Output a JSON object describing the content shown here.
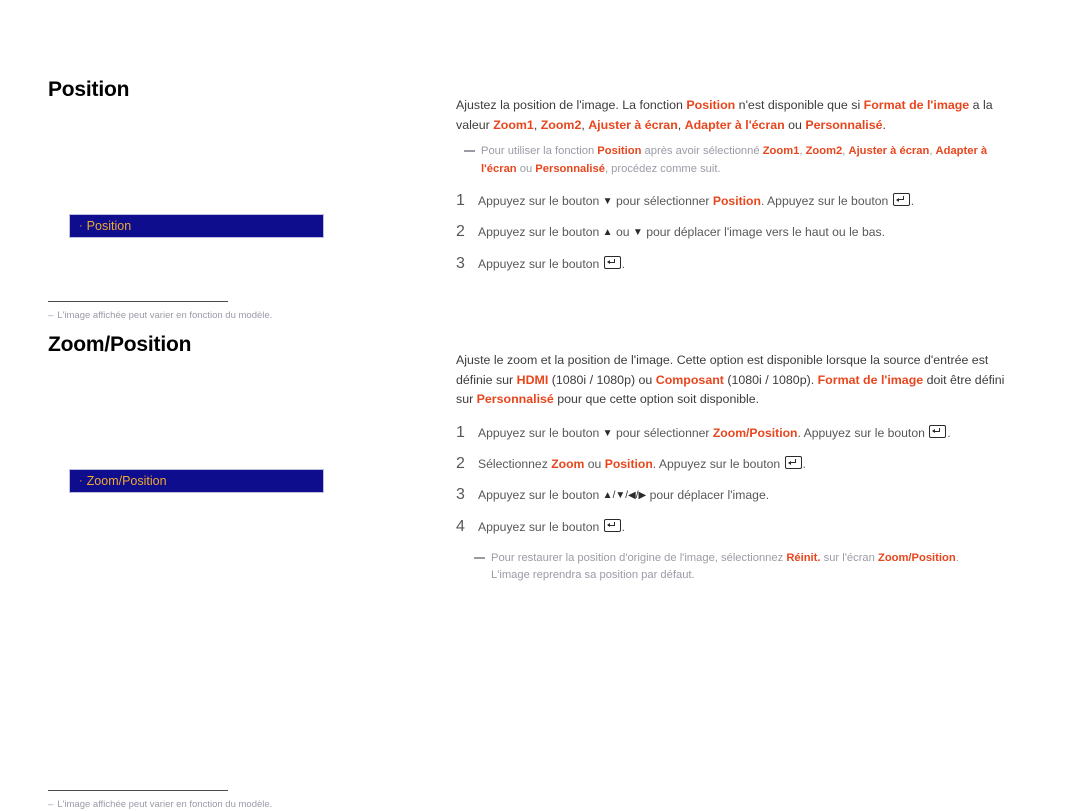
{
  "meta": {
    "accent_highlight": "#e8461d",
    "osd_panel_bg": "#0d0d8e",
    "osd_panel_text": "#f0a830",
    "body_text": "#58585b",
    "note_text": "#9b9ba6"
  },
  "sections": [
    {
      "id": "position",
      "heading": "Position",
      "osd_panel": {
        "bullet": "·",
        "label": "Position"
      },
      "footnote": {
        "dash": "–",
        "text": "L'image affichée peut varier en fonction du modèle."
      },
      "intro": {
        "p1_a": "Ajustez la position de l'image. La fonction ",
        "p1_hl1": "Position",
        "p1_b": " n'est disponible que si ",
        "p1_hl2": "Format de l'image",
        "p1_c": " a la valeur ",
        "p1_hl3": "Zoom1",
        "p1_d": ", ",
        "p1_hl4": "Zoom2",
        "p1_e": ", ",
        "p1_hl5": "Ajuster à écran",
        "p1_f": ", ",
        "p1_hl6": "Adapter à l'écran",
        "p1_g": " ou ",
        "p1_hl7": "Personnalisé",
        "p1_h": "."
      },
      "note": {
        "a": "Pour utiliser la fonction ",
        "hl1": "Position",
        "b": " après avoir sélectionné ",
        "hl2": "Zoom1",
        "c": ", ",
        "hl3": "Zoom2",
        "d": ", ",
        "hl4": "Ajuster à écran",
        "e": ", ",
        "hl5": "Adapter à l'écran",
        "f": " ou ",
        "hl6": "Personnalisé",
        "g": ", procédez comme suit."
      },
      "steps": [
        {
          "num": "1",
          "a": "Appuyez sur le bouton ",
          "arrow1": "▼",
          "b": " pour sélectionner ",
          "hl": "Position",
          "c": ". Appuyez sur le bouton ",
          "d": "."
        },
        {
          "num": "2",
          "a": "Appuyez sur le bouton ",
          "arrow1": "▲",
          "b": " ou ",
          "arrow2": "▼",
          "c": " pour déplacer l'image vers le haut ou le bas."
        },
        {
          "num": "3",
          "a": "Appuyez sur le bouton ",
          "d": "."
        }
      ]
    },
    {
      "id": "zoomposition",
      "heading": "Zoom/Position",
      "osd_panel": {
        "bullet": "·",
        "label": "Zoom/Position"
      },
      "footnote": {
        "dash": "–",
        "text": "L'image affichée peut varier en fonction du modèle."
      },
      "intro": {
        "p1_a": "Ajuste le zoom et la position de l'image. Cette option est disponible lorsque la source d'entrée est définie sur ",
        "p1_hl1": "HDMI",
        "p1_b": " (1080i / 1080p) ou ",
        "p1_hl2": "Composant",
        "p1_c": " (1080i / 1080p). ",
        "p1_hl3": "Format de l'image",
        "p1_d": " doit être défini sur ",
        "p1_hl4": "Personnalisé",
        "p1_e": " pour que cette option soit disponible."
      },
      "steps": [
        {
          "num": "1",
          "a": "Appuyez sur le bouton ",
          "arrow1": "▼",
          "b": " pour sélectionner ",
          "hl": "Zoom/Position",
          "c": ". Appuyez sur le bouton ",
          "d": "."
        },
        {
          "num": "2",
          "a": "Sélectionnez ",
          "hl": "Zoom",
          "b": " ou ",
          "hl2": "Position",
          "c": ". Appuyez sur le bouton ",
          "d": "."
        },
        {
          "num": "3",
          "a": "Appuyez sur le bouton ",
          "arrows": "▲/▼/◀/▶",
          "b": " pour déplacer l'image."
        },
        {
          "num": "4",
          "a": "Appuyez sur le bouton ",
          "d": "."
        }
      ],
      "note": {
        "a": "Pour restaurer la position d'origine de l'image, sélectionnez ",
        "hl1": "Réinit.",
        "b": " sur l'écran ",
        "hl2": "Zoom/Position",
        "c": ".",
        "line2": "L'image reprendra sa position par défaut."
      }
    }
  ]
}
